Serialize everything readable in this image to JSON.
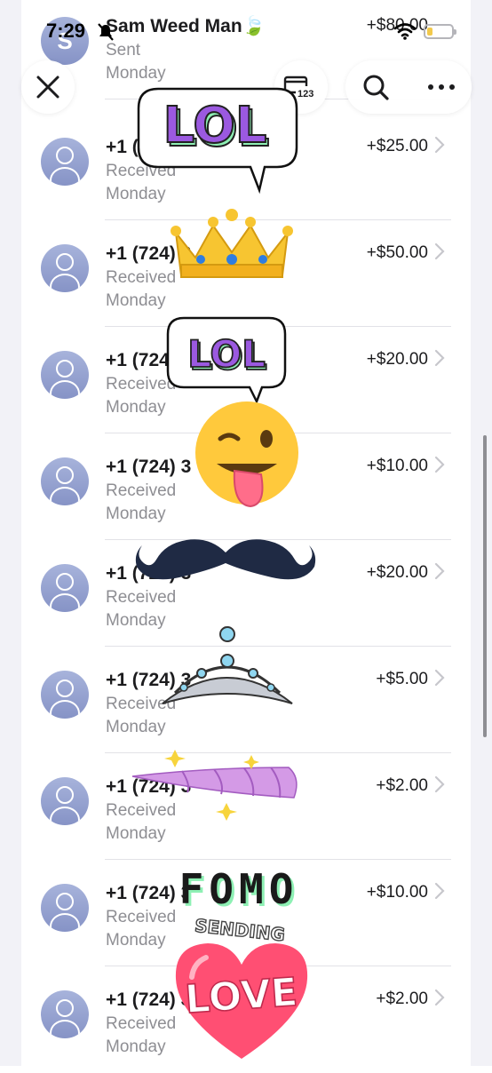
{
  "status_bar": {
    "time": "7:29"
  },
  "toolbar": {
    "close_icon": "close-icon",
    "card_icon": "card-123-icon",
    "card_badge": "123",
    "search_icon": "search-icon",
    "more_icon": "ellipsis-icon"
  },
  "transactions": [
    {
      "name": "Sam Weed Man🍃",
      "status": "Sent",
      "day": "Monday",
      "amount": "+$80.00",
      "avatar_initial": "S"
    },
    {
      "name": "+1 (724) 3",
      "status": "Received",
      "day": "Monday",
      "amount": "+$25.00"
    },
    {
      "name": "+1 (724) 3",
      "status": "Received",
      "day": "Monday",
      "amount": "+$50.00"
    },
    {
      "name": "+1 (724) 3",
      "status": "Received",
      "day": "Monday",
      "amount": "+$20.00"
    },
    {
      "name": "+1 (724) 3",
      "status": "Received",
      "day": "Monday",
      "amount": "+$10.00"
    },
    {
      "name": "+1 (724) 3",
      "status": "Received",
      "day": "Monday",
      "amount": "+$20.00"
    },
    {
      "name": "+1 (724) 3",
      "status": "Received",
      "day": "Monday",
      "amount": "+$5.00"
    },
    {
      "name": "+1 (724) 3",
      "status": "Received",
      "day": "Monday",
      "amount": "+$2.00"
    },
    {
      "name": "+1 (724) 3",
      "status": "Received",
      "day": "Monday",
      "amount": "+$10.00"
    },
    {
      "name": "+1 (724) 3",
      "status": "Received",
      "day": "Monday",
      "amount": "+$2.00"
    }
  ],
  "stickers": {
    "lol_1": "LOL",
    "lol_2": "LOL",
    "fomo": "FOMO",
    "sending": "SENDING",
    "love": "LOVE"
  },
  "colors": {
    "avatar": "#97a3d2",
    "secondary_text": "#8e8e93",
    "lol_purple": "#9b59e0",
    "lol_green": "#8ef0b4",
    "love_heart": "#ff4f73"
  }
}
